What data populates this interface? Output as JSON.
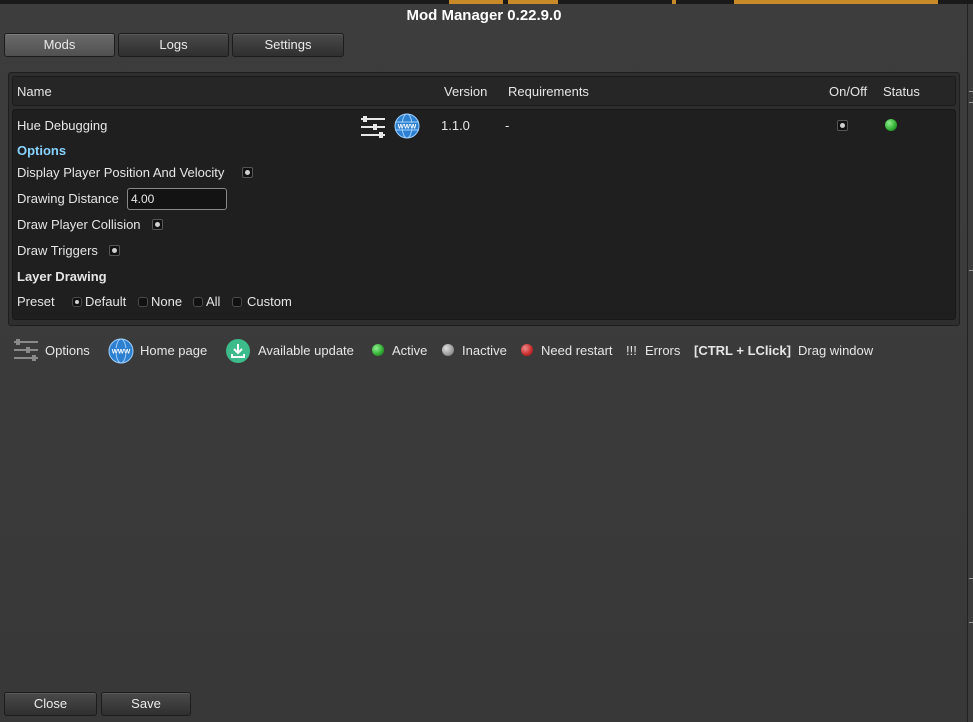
{
  "window": {
    "title": "Mod Manager 0.22.9.0"
  },
  "tabs": [
    {
      "label": "Mods",
      "active": true
    },
    {
      "label": "Logs",
      "active": false
    },
    {
      "label": "Settings",
      "active": false
    }
  ],
  "table": {
    "headers": {
      "name": "Name",
      "version": "Version",
      "requirements": "Requirements",
      "onoff": "On/Off",
      "status": "Status"
    },
    "mod": {
      "name": "Hue Debugging",
      "version": "1.1.0",
      "requirements": "-",
      "enabled": true,
      "status": "active"
    },
    "options": {
      "heading": "Options",
      "display_player_position": {
        "label": "Display Player Position And Velocity",
        "checked": true
      },
      "drawing_distance": {
        "label": "Drawing Distance",
        "value": "4.00"
      },
      "draw_player_collision": {
        "label": "Draw Player Collision",
        "checked": true
      },
      "draw_triggers": {
        "label": "Draw Triggers",
        "checked": true
      },
      "layer_drawing": "Layer Drawing",
      "preset": {
        "label": "Preset",
        "options": [
          "Default",
          "None",
          "All",
          "Custom"
        ],
        "selected": "Default"
      }
    }
  },
  "legend": {
    "options": "Options",
    "home_page": "Home page",
    "available_update": "Available update",
    "active": "Active",
    "inactive": "Inactive",
    "need_restart": "Need restart",
    "errors_symbol": "!!!",
    "errors": "Errors",
    "shortcut": "[CTRL + LClick]",
    "drag_window": "Drag window"
  },
  "footer": {
    "close_label": "Close",
    "save_label": "Save"
  },
  "colors": {
    "active": "#3fbf3f",
    "inactive": "#9a9a9a",
    "need_restart": "#c62a2a",
    "update": "#3dbb8a",
    "globe": "#2d7fd0",
    "options_heading": "#86d3ff"
  },
  "icons": {
    "options": "sliders-icon",
    "home_page": "globe-www-icon",
    "update": "download-icon"
  }
}
